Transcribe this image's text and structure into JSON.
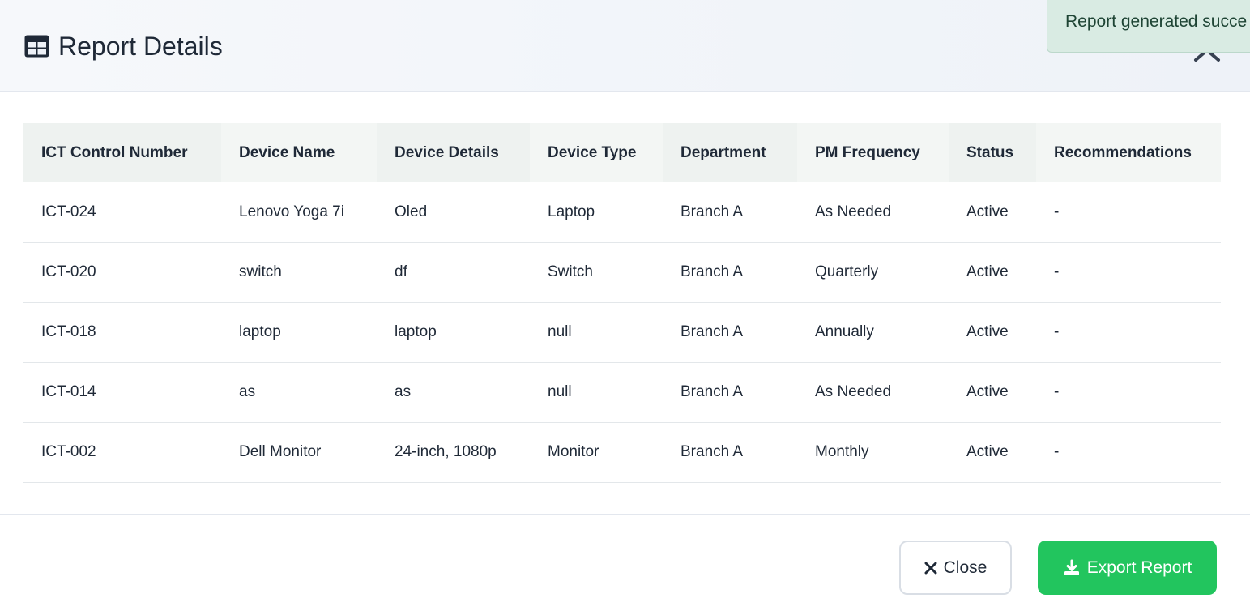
{
  "header": {
    "title": "Report Details",
    "title_icon": "table-icon",
    "close_icon": "close-icon"
  },
  "toast": {
    "message": "Report generated succe",
    "background": "#d9ebe3"
  },
  "table": {
    "columns": [
      "ICT Control Number",
      "Device Name",
      "Device Details",
      "Device Type",
      "Department",
      "PM Frequency",
      "Status",
      "Recommendations"
    ],
    "rows": [
      [
        "ICT-024",
        "Lenovo Yoga 7i",
        "Oled",
        "Laptop",
        "Branch A",
        "As Needed",
        "Active",
        "-"
      ],
      [
        "ICT-020",
        "switch",
        "df",
        "Switch",
        "Branch A",
        "Quarterly",
        "Active",
        "-"
      ],
      [
        "ICT-018",
        "laptop",
        "laptop",
        "null",
        "Branch A",
        "Annually",
        "Active",
        "-"
      ],
      [
        "ICT-014",
        "as",
        "as",
        "null",
        "Branch A",
        "As Needed",
        "Active",
        "-"
      ],
      [
        "ICT-002",
        "Dell Monitor",
        "24-inch, 1080p",
        "Monitor",
        "Branch A",
        "Monthly",
        "Active",
        "-"
      ]
    ]
  },
  "footer": {
    "close_label": "Close",
    "close_icon": "x-icon",
    "export_label": "Export Report",
    "export_icon": "download-icon",
    "export_color": "#22c55e"
  }
}
